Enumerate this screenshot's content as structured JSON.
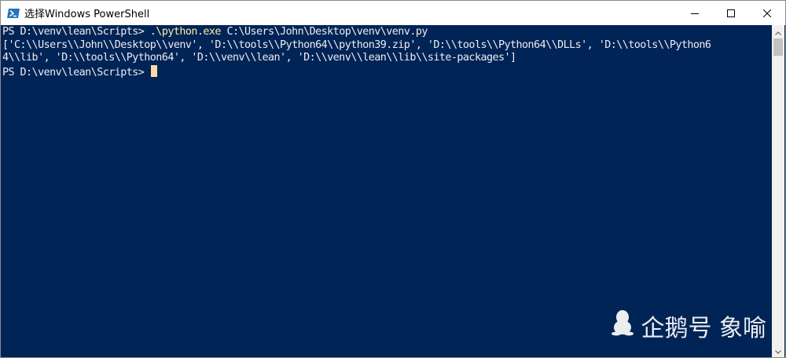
{
  "window": {
    "title": "选择Windows PowerShell",
    "icon": "powershell-icon",
    "controls": [
      "minimize-icon",
      "maximize-icon",
      "close-icon"
    ]
  },
  "colors": {
    "console_background": "#012456",
    "console_text": "#eeedf0",
    "command_highlight": "#f9f1a5",
    "cursor": "#fedba9",
    "titlebar_background": "#ffffff"
  },
  "console": {
    "line1": {
      "prompt": "PS D:\\venv\\lean\\Scripts> ",
      "exe": ".\\python.exe",
      "args": " C:\\Users\\John\\Desktop\\venv\\venv.py"
    },
    "output_line1": "['C:\\\\Users\\\\John\\\\Desktop\\\\venv', 'D:\\\\tools\\\\Python64\\\\python39.zip', 'D:\\\\tools\\\\Python64\\\\DLLs', 'D:\\\\tools\\\\Python6",
    "output_line2": "4\\\\lib', 'D:\\\\tools\\\\Python64', 'D:\\\\venv\\\\lean', 'D:\\\\venv\\\\lean\\\\lib\\\\site-packages']",
    "line3_prompt": "PS D:\\venv\\lean\\Scripts> "
  },
  "watermark": {
    "text": "企鹅号 象喻",
    "icon": "penguin-icon"
  }
}
